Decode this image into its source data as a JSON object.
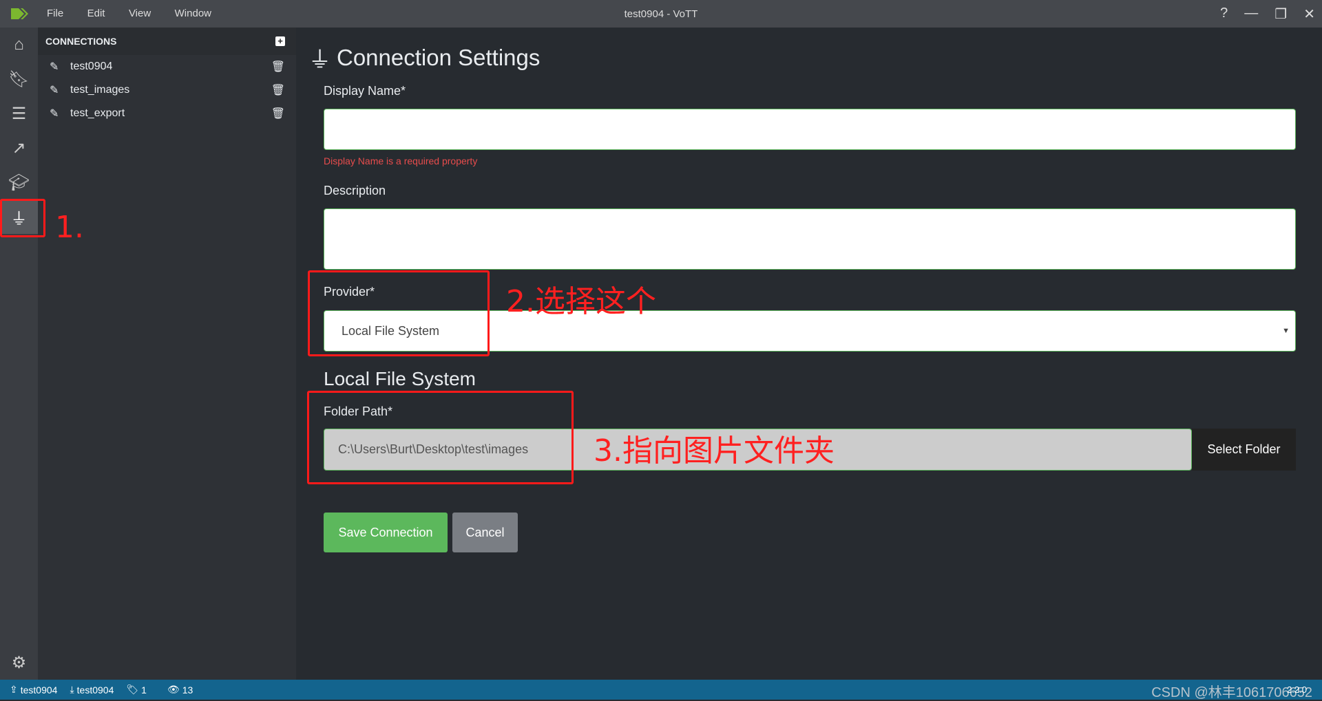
{
  "window": {
    "title": "test0904 - VoTT",
    "menu": [
      "File",
      "Edit",
      "View",
      "Window"
    ]
  },
  "sidebar": {
    "icons": [
      "home-icon",
      "bookmark-icon",
      "sliders-icon",
      "export-icon",
      "graduation-cap-icon",
      "plug-icon"
    ],
    "active": "plug-icon"
  },
  "connections": {
    "header": "CONNECTIONS",
    "items": [
      {
        "label": "test0904"
      },
      {
        "label": "test_images"
      },
      {
        "label": "test_export"
      }
    ]
  },
  "form": {
    "title": "Connection Settings",
    "display_name_label": "Display Name*",
    "display_name_value": "",
    "display_name_error": "Display Name is a required property",
    "description_label": "Description",
    "description_value": "",
    "provider_label": "Provider*",
    "provider_value": "Local File System",
    "section_title": "Local File System",
    "folder_path_label": "Folder Path*",
    "folder_path_value": "C:\\Users\\Burt\\Desktop\\test\\images",
    "select_folder": "Select Folder",
    "save": "Save Connection",
    "cancel": "Cancel"
  },
  "annotations": [
    "1.",
    "2.选择这个",
    "3.指向图片文件夹"
  ],
  "status": {
    "source": "test0904",
    "target": "test0904",
    "tags": "1",
    "visited": "13",
    "version": "2.2.0"
  },
  "watermark": "CSDN @林丰1061706652",
  "colors": {
    "accent": "#5cb85c",
    "status_bar": "#13648e",
    "annotation": "#ff1a1a",
    "error": "#e74c4c"
  }
}
